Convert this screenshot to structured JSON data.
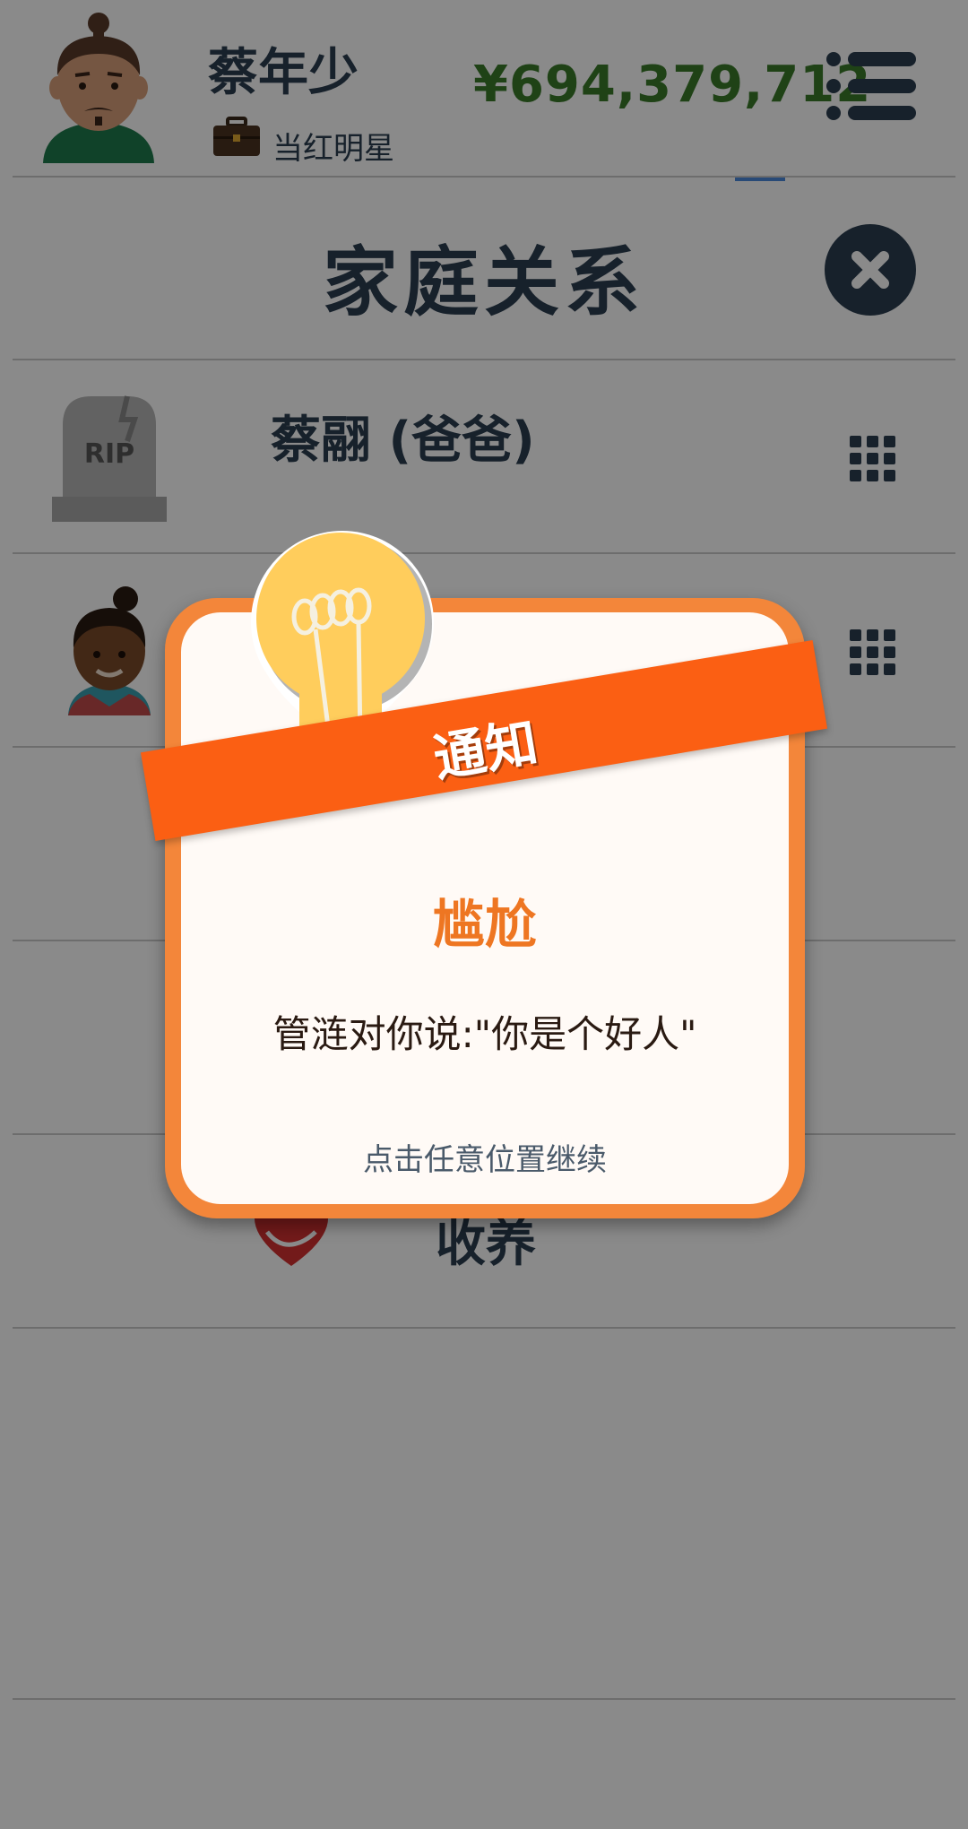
{
  "header": {
    "player_name": "蔡年少",
    "job_title": "当红明星",
    "money": "¥694,379,712",
    "avatar_icon": "male-avatar-icon",
    "job_icon": "briefcase-icon",
    "menu_icon": "menu-list-icon"
  },
  "section": {
    "title": "家庭关系",
    "close_icon": "close-icon"
  },
  "family": {
    "rows": [
      {
        "name": "蔡翮 (爸爸)",
        "icon": "rip-tombstone-icon",
        "action_icon": "grid-icon"
      },
      {
        "name": "",
        "icon": "female-avatar-icon",
        "action_icon": "grid-icon"
      }
    ],
    "adopt_label": "收养",
    "adopt_icon": "adopt-heart-hands-icon"
  },
  "notice": {
    "banner": "通知",
    "title": "尴尬",
    "message": "管涟对你说:\"你是个好人\"",
    "continue_hint": "点击任意位置继续",
    "icon": "lightbulb-icon"
  },
  "colors": {
    "money": "#3a7a2a",
    "text": "#2c3e50",
    "ribbon": "#fb5f13",
    "modal_frame": "#f3863a",
    "notice_title": "#ee7622"
  }
}
